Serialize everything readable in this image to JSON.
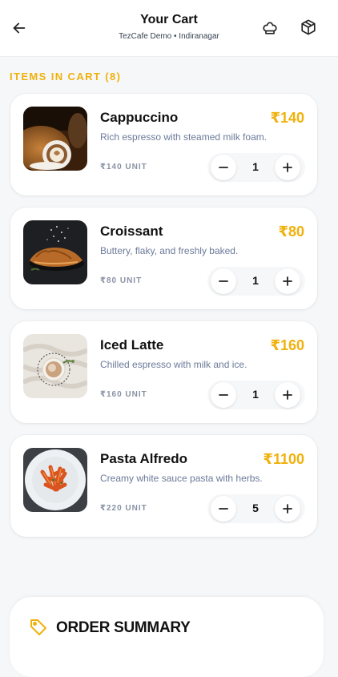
{
  "header": {
    "title": "Your Cart",
    "subtitle": "TezCafe Demo • Indiranagar",
    "back_icon": "arrow-left-icon",
    "chef_icon": "chef-hat-icon",
    "box_icon": "package-icon"
  },
  "cart": {
    "section_label": "ITEMS IN CART (8)",
    "items": [
      {
        "name": "Cappuccino",
        "price": "₹140",
        "desc": "Rich espresso with steamed milk foam.",
        "unit": "₹140 UNIT",
        "qty": "1"
      },
      {
        "name": "Croissant",
        "price": "₹80",
        "desc": "Buttery, flaky, and freshly baked.",
        "unit": "₹80 UNIT",
        "qty": "1"
      },
      {
        "name": "Iced Latte",
        "price": "₹160",
        "desc": "Chilled espresso with milk and ice.",
        "unit": "₹160 UNIT",
        "qty": "1"
      },
      {
        "name": "Pasta Alfredo",
        "price": "₹1100",
        "desc": "Creamy white sauce pasta with herbs.",
        "unit": "₹220 UNIT",
        "qty": "5"
      }
    ]
  },
  "summary": {
    "title": "ORDER SUMMARY",
    "icon": "tag-icon"
  },
  "colors": {
    "accent": "#f0b10c",
    "background": "#f6f7f9",
    "muted": "#6b7a99"
  }
}
